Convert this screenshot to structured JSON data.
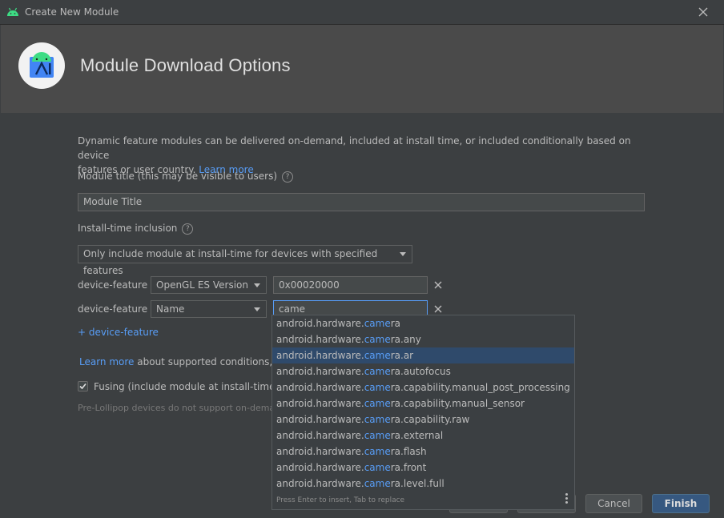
{
  "window": {
    "title": "Create New Module"
  },
  "header": {
    "title": "Module Download Options"
  },
  "intro": {
    "text": "Dynamic feature modules can be delivered on-demand, included at install time, or included conditionally based on device",
    "text2": "features or user country.",
    "link": "Learn more"
  },
  "module_title": {
    "label": "Module title (this may be visible to users)",
    "value": "Module Title"
  },
  "install_time": {
    "label": "Install-time inclusion",
    "selected": "Only include module at install-time for devices with specified features"
  },
  "conditions": [
    {
      "label": "device-feature",
      "type": "OpenGL ES Version",
      "value": "0x00020000"
    },
    {
      "label": "device-feature",
      "type": "Name",
      "value": "came"
    }
  ],
  "add_condition": "+ device-feature",
  "learn_more_conditions": {
    "link": "Learn more",
    "text": "about supported conditions, suc"
  },
  "fusing": {
    "checked": true,
    "label": "Fusing (include module at install-time fo"
  },
  "pre_lollipop": "Pre-Lollipop devices do not support on-demar",
  "autocomplete": {
    "match": "came",
    "items": [
      {
        "prefix": "android.hardware.",
        "match": "came",
        "suffix": "ra"
      },
      {
        "prefix": "android.hardware.",
        "match": "came",
        "suffix": "ra.any"
      },
      {
        "prefix": "android.hardware.",
        "match": "came",
        "suffix": "ra.ar"
      },
      {
        "prefix": "android.hardware.",
        "match": "came",
        "suffix": "ra.autofocus"
      },
      {
        "prefix": "android.hardware.",
        "match": "came",
        "suffix": "ra.capability.manual_post_processing"
      },
      {
        "prefix": "android.hardware.",
        "match": "came",
        "suffix": "ra.capability.manual_sensor"
      },
      {
        "prefix": "android.hardware.",
        "match": "came",
        "suffix": "ra.capability.raw"
      },
      {
        "prefix": "android.hardware.",
        "match": "came",
        "suffix": "ra.external"
      },
      {
        "prefix": "android.hardware.",
        "match": "came",
        "suffix": "ra.flash"
      },
      {
        "prefix": "android.hardware.",
        "match": "came",
        "suffix": "ra.front"
      },
      {
        "prefix": "android.hardware.",
        "match": "came",
        "suffix": "ra.level.full"
      }
    ],
    "selected_index": 2,
    "footer": "Press Enter to insert, Tab to replace"
  },
  "buttons": {
    "cancel": "Cancel",
    "finish": "Finish"
  },
  "colors": {
    "accent": "#589df6",
    "primary_button": "#365880",
    "background": "#3c3f41",
    "header": "#4a4a4a"
  }
}
